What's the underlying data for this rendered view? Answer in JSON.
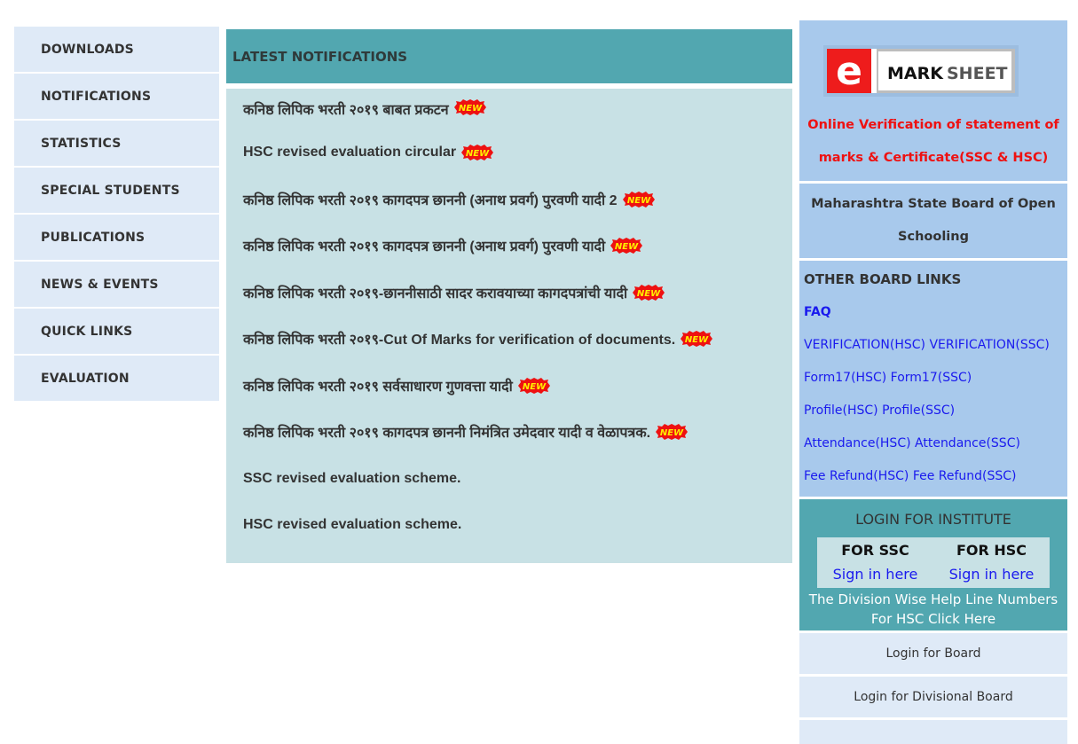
{
  "sidebar": {
    "items": [
      {
        "label": "DOWNLOADS"
      },
      {
        "label": "NOTIFICATIONS"
      },
      {
        "label": "STATISTICS"
      },
      {
        "label": "SPECIAL STUDENTS"
      },
      {
        "label": "PUBLICATIONS"
      },
      {
        "label": "NEWS & EVENTS"
      },
      {
        "label": "QUICK LINKS"
      },
      {
        "label": "EVALUATION"
      }
    ]
  },
  "main": {
    "title": "LATEST NOTIFICATIONS",
    "new_badge_text": "NEW",
    "notifications": [
      {
        "text": "कनिष्ठ लिपिक भरती २०१९ बाबत प्रकटन",
        "is_new": true
      },
      {
        "text": "HSC revised evaluation circular",
        "is_new": true
      },
      {
        "text": "कनिष्ठ लिपिक भरती २०१९ कागदपत्र छाननी (अनाथ प्रवर्ग) पुरवणी यादी 2",
        "is_new": true
      },
      {
        "text": "कनिष्ठ लिपिक भरती २०१९ कागदपत्र छाननी (अनाथ प्रवर्ग) पुरवणी यादी",
        "is_new": true
      },
      {
        "text": "कनिष्ठ लिपिक भरती २०१९-छाननीसाठी सादर करावयाच्या कागदपत्रांची यादी",
        "is_new": true
      },
      {
        "text": "कनिष्ठ लिपिक भरती २०१९-Cut Of Marks for verification of documents.",
        "is_new": true
      },
      {
        "text": "कनिष्ठ लिपिक भरती २०१९ सर्वसाधारण गुणवत्ता यादी",
        "is_new": true
      },
      {
        "text": "कनिष्ठ लिपिक भरती २०१९ कागदपत्र छाननी निमंत्रित उमेदवार यादी व वेळापत्रक.",
        "is_new": true
      },
      {
        "text": "SSC revised evaluation scheme.",
        "is_new": false
      },
      {
        "text": "HSC revised evaluation scheme.",
        "is_new": false
      }
    ]
  },
  "right": {
    "logo": {
      "letter": "e",
      "text_main": "MARK",
      "text_sub": "SHEET"
    },
    "verification_line1": "Online Verification of statement of",
    "verification_line2": "marks & Certificate(SSC & HSC)",
    "msbos": "Maharashtra State Board of Open Schooling",
    "other_links": {
      "title": "OTHER BOARD LINKS",
      "faq": "FAQ",
      "rows": [
        [
          "VERIFICATION(HSC)",
          "VERIFICATION(SSC)"
        ],
        [
          "Form17(HSC)",
          "Form17(SSC)"
        ],
        [
          "Profile(HSC)",
          "Profile(SSC)"
        ],
        [
          "Attendance(HSC)",
          "Attendance(SSC)"
        ],
        [
          "Fee Refund(HSC)",
          "Fee Refund(SSC)"
        ]
      ]
    },
    "institute_login": {
      "title": "LOGIN FOR INSTITUTE",
      "ssc_label": "FOR SSC",
      "hsc_label": "FOR HSC",
      "ssc_link": "Sign in here",
      "hsc_link": "Sign in here",
      "helpline_line1": "The Division Wise Help Line Numbers",
      "helpline_line2": "For HSC Click Here"
    },
    "board_login": "Login for Board",
    "divisional_login": "Login for Divisional Board"
  },
  "colors": {
    "teal": "#52a7b0",
    "light_teal": "#c8e1e5",
    "sidebar_bg": "#dfeaf7",
    "right_blue": "#a8c9ec",
    "link_blue": "#1a1aee",
    "alert_red": "#ee1111"
  }
}
